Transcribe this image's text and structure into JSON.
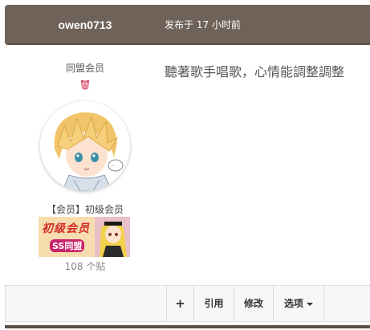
{
  "header": {
    "author": "owen0713",
    "time": "发布于 17 小时前"
  },
  "author_panel": {
    "group": "同盟会员",
    "group_icon": "pink-badge-icon",
    "avatar": "anime-avatar",
    "rank": "【会员】初级会员",
    "rank_image_text_1": "初级会员",
    "rank_image_text_2": "SS同盟",
    "post_count": "108 个贴"
  },
  "post": {
    "body": "聽著歌手唱歌，心情能調整調整"
  },
  "actions": {
    "plus": "+",
    "quote": "引用",
    "edit": "修改",
    "options": "选项"
  },
  "colors": {
    "header_bg": "#6f6259",
    "header_text": "#ffffff",
    "body_text": "#555555",
    "rank_red": "#d22b2b"
  }
}
